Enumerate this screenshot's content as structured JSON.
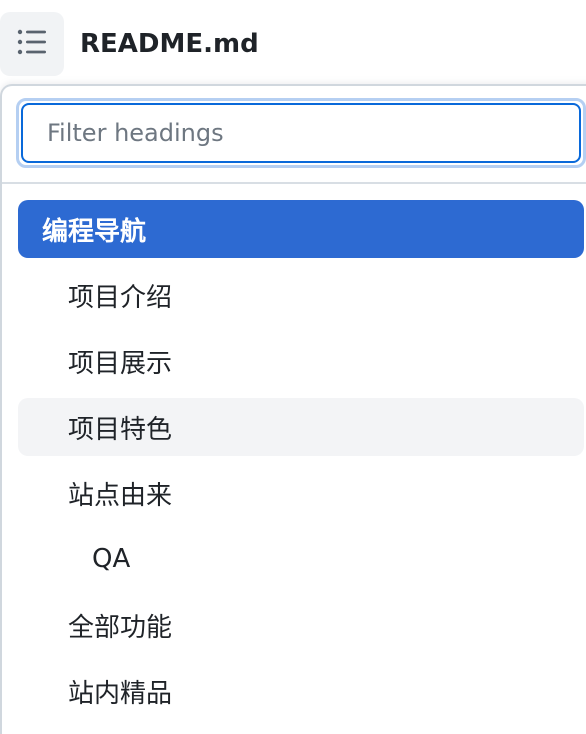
{
  "header": {
    "toc_icon": "list-unordered-icon",
    "title": "README.md"
  },
  "filter": {
    "placeholder": "Filter headings",
    "value": ""
  },
  "headings": [
    {
      "label": "编程导航",
      "state": "active"
    },
    {
      "label": "项目介绍",
      "state": ""
    },
    {
      "label": "项目展示",
      "state": ""
    },
    {
      "label": "项目特色",
      "state": "hover"
    },
    {
      "label": "站点由来",
      "state": ""
    },
    {
      "label": "QA",
      "state": ""
    },
    {
      "label": "全部功能",
      "state": ""
    },
    {
      "label": "站内精品",
      "state": ""
    }
  ],
  "colors": {
    "active_bg": "#2d6ad2",
    "hover_bg": "#f3f4f6",
    "focus_border": "#0969da"
  }
}
